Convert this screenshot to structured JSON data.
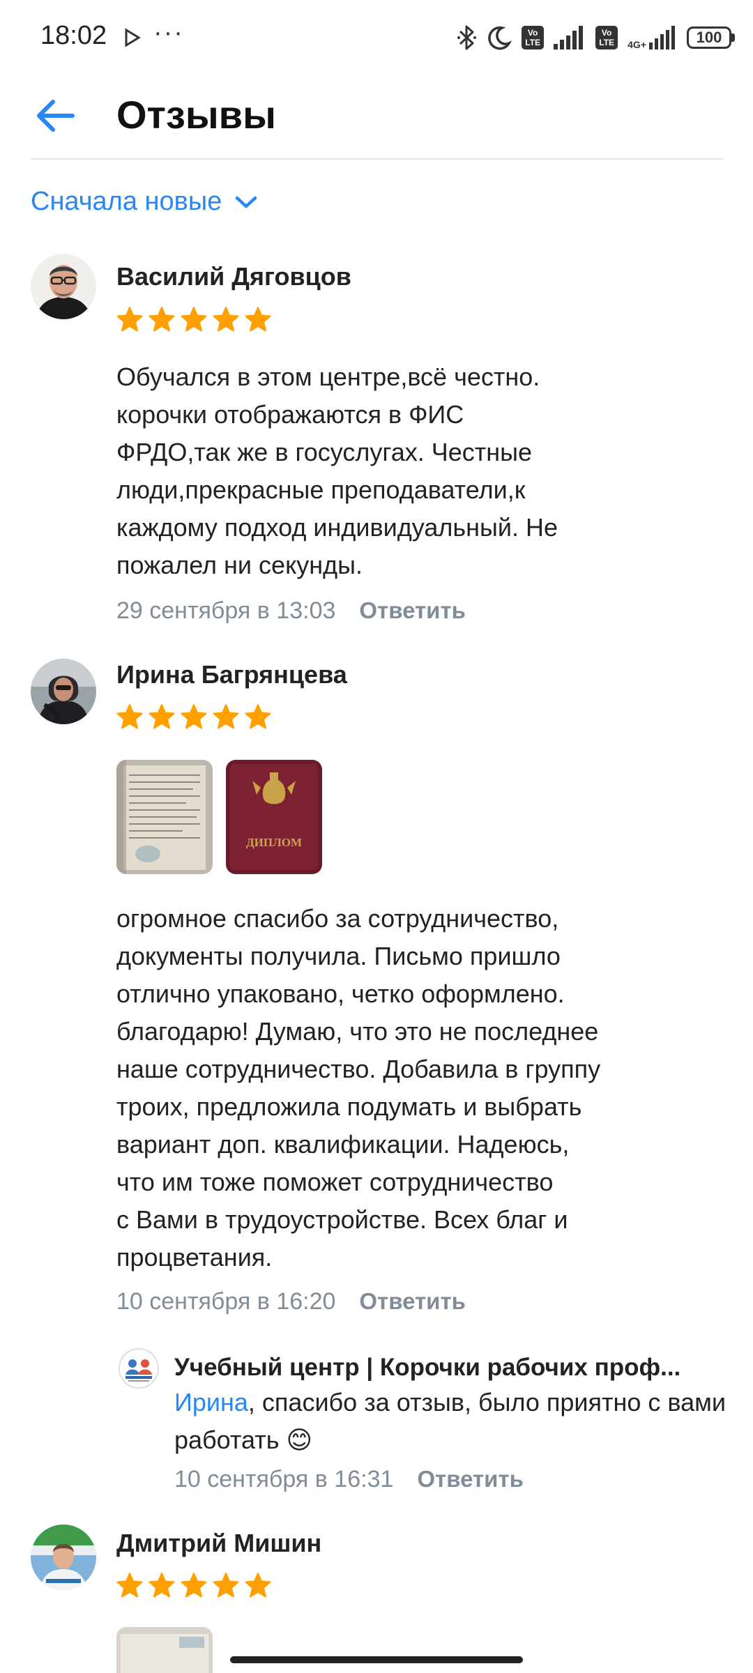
{
  "status_bar": {
    "time": "18:02",
    "dots": "···",
    "network": "4G+",
    "volte_label": "Vo LTE",
    "battery": "100",
    "icons": [
      "play-icon",
      "bluetooth-icon",
      "moon-icon",
      "volte-icon",
      "signal-icon",
      "battery-icon"
    ]
  },
  "header": {
    "title": "Отзывы",
    "back_icon": "arrow-left-icon"
  },
  "sort": {
    "label": "Сначала новые",
    "icon": "chevron-down-icon"
  },
  "reviews": [
    {
      "name": "Василий Дяговцов",
      "rating": 5,
      "text": "Обучался в этом центре,всё честно.\nкорочки отображаются в ФИС\nФРДО,так же в госуслугах. Честные\nлюди,прекрасные преподаватели,к\nкаждому подход индивидуальный. Не\nпожалел ни секунды.",
      "date": "29 сентября в 13:03",
      "reply_label": "Ответить"
    },
    {
      "name": "Ирина Багрянцева",
      "rating": 5,
      "photos": [
        {
          "label": ""
        },
        {
          "label": "ДИПЛОМ"
        }
      ],
      "text": "огромное спасибо за сотрудничество,\nдокументы получила. Письмо пришло\nотлично упаковано, четко оформлено.\nблагодарю! Думаю, что это не последнее\nнаше сотрудничество. Добавила в группу\nтроих, предложила подумать и выбрать\nвариант доп. квалификации. Надеюсь,\nчто им тоже поможет сотрудничество\nс Вами в трудоустройстве. Всех благ и\nпроцветания.",
      "date": "10 сентября в 16:20",
      "reply_label": "Ответить",
      "reply": {
        "name": "Учебный центр | Корочки рабочих проф...",
        "mention": "Ирина",
        "text": ", спасибо за отзыв, было приятно с вами работать 😊",
        "date": "10 сентября в 16:31",
        "reply_label": "Ответить"
      }
    },
    {
      "name": "Дмитрий Мишин",
      "rating": 5
    }
  ],
  "colors": {
    "accent": "#2787f5",
    "star": "#ffa000",
    "secondary_text": "#818c99",
    "divider": "#e3e4e8"
  }
}
